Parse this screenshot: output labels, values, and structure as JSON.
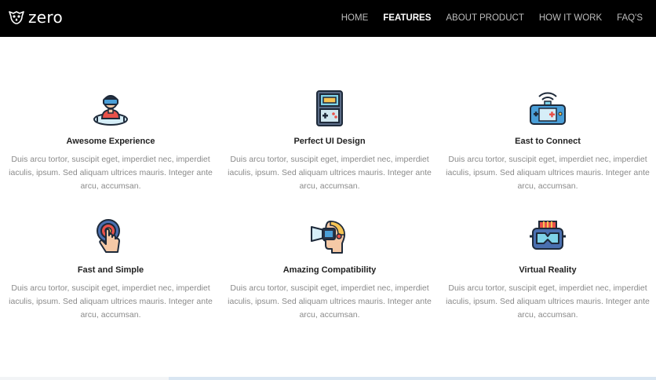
{
  "brand": {
    "name": "zero",
    "logo_icon": "owl-logo-icon"
  },
  "nav": {
    "items": [
      {
        "label": "HOME",
        "active": false
      },
      {
        "label": "FEATURES",
        "active": true
      },
      {
        "label": "ABOUT PRODUCT",
        "active": false
      },
      {
        "label": "HOW IT WORK",
        "active": false
      },
      {
        "label": "FAQ'S",
        "active": false
      }
    ]
  },
  "features": [
    {
      "title": "Awesome Experience",
      "icon": "vr-headset-person-icon",
      "desc": "Duis arcu tortor, suscipit eget, imperdiet nec, imperdiet iaculis, ipsum. Sed aliquam ultrices mauris. Integer ante arcu, accumsan."
    },
    {
      "title": "Perfect UI Design",
      "icon": "handheld-console-icon",
      "desc": "Duis arcu tortor, suscipit eget, imperdiet nec, imperdiet iaculis, ipsum. Sed aliquam ultrices mauris. Integer ante arcu, accumsan."
    },
    {
      "title": "East to Connect",
      "icon": "wireless-gamepad-icon",
      "desc": "Duis arcu tortor, suscipit eget, imperdiet nec, imperdiet iaculis, ipsum. Sed aliquam ultrices mauris. Integer ante arcu, accumsan."
    },
    {
      "title": "Fast and Simple",
      "icon": "touch-finger-icon",
      "desc": "Duis arcu tortor, suscipit eget, imperdiet nec, imperdiet iaculis, ipsum. Sed aliquam ultrices mauris. Integer ante arcu, accumsan."
    },
    {
      "title": "Amazing Compatibility",
      "icon": "vr-head-profile-icon",
      "desc": "Duis arcu tortor, suscipit eget, imperdiet nec, imperdiet iaculis, ipsum. Sed aliquam ultrices mauris. Integer ante arcu, accumsan."
    },
    {
      "title": "Virtual Reality",
      "icon": "vr-goggles-icon",
      "desc": "Duis arcu tortor, suscipit eget, imperdiet nec, imperdiet iaculis, ipsum. Sed aliquam ultrices mauris. Integer ante arcu, accumsan."
    }
  ],
  "colors": {
    "nav_background": "#000000",
    "nav_text": "#bdbdbd",
    "nav_active": "#ffffff",
    "title_text": "#222222",
    "desc_text": "#8a8a8a"
  }
}
